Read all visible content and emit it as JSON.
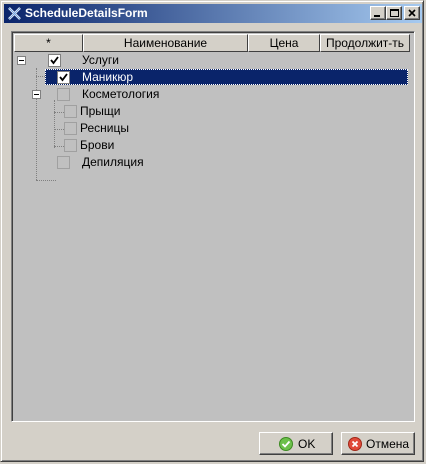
{
  "window": {
    "title": "ScheduleDetailsForm",
    "controls": {
      "minimize_icon": "minimize-icon",
      "maximize_icon": "maximize-icon",
      "close_icon": "close-icon"
    }
  },
  "grid": {
    "columns": [
      "*",
      "Наименование",
      "Цена",
      "Продолжит-ть"
    ],
    "rows": [
      {
        "label": "Услуги",
        "checked": true,
        "expanded": true,
        "selected": false
      },
      {
        "label": "Маникюр",
        "checked": true,
        "selected": true
      },
      {
        "label": "Косметология",
        "checked": false,
        "expanded": true,
        "selected": false
      },
      {
        "label": "Прыщи",
        "checked": false,
        "selected": false
      },
      {
        "label": "Ресницы",
        "checked": false,
        "selected": false
      },
      {
        "label": "Брови",
        "checked": false,
        "selected": false
      },
      {
        "label": "Депиляция",
        "checked": false,
        "selected": false
      }
    ]
  },
  "buttons": {
    "ok_label": "OK",
    "cancel_label": "Отмена",
    "ok_icon": "check-circle-icon",
    "cancel_icon": "cancel-circle-icon"
  },
  "colors": {
    "title_start": "#0a246a",
    "title_end": "#a6caf0",
    "selection": "#0a246a",
    "panel": "#c0c0c0",
    "face": "#d4d0c8"
  }
}
